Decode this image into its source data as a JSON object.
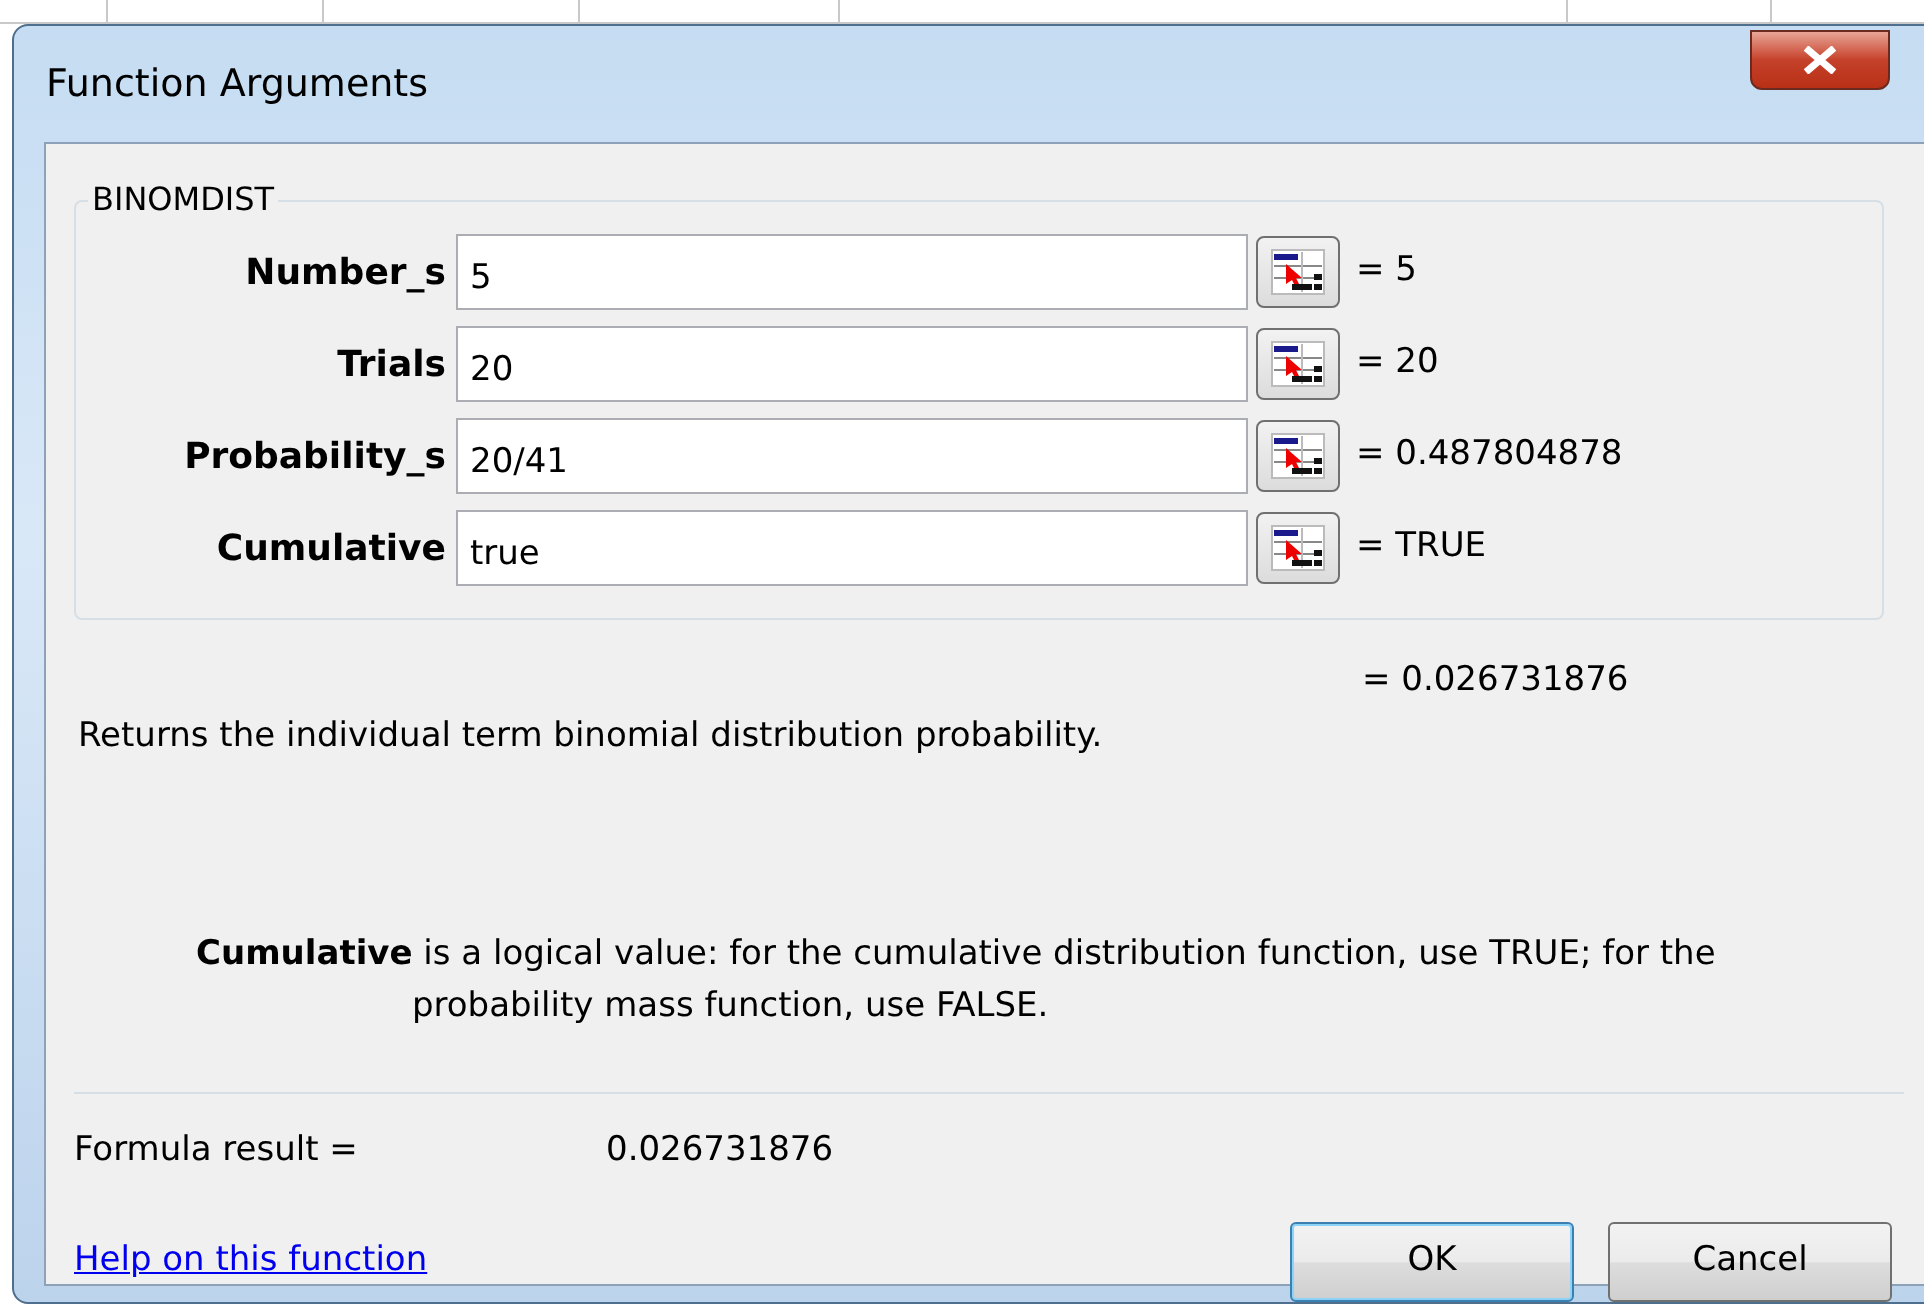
{
  "window": {
    "title": "Function Arguments"
  },
  "function_name": "BINOMDIST",
  "arguments": [
    {
      "label": "Number_s",
      "value": "5",
      "result": "= 5"
    },
    {
      "label": "Trials",
      "value": "20",
      "result": "= 20"
    },
    {
      "label": "Probability_s",
      "value": "20/41",
      "result": "= 0.487804878"
    },
    {
      "label": "Cumulative",
      "value": "true",
      "result": "= TRUE"
    }
  ],
  "overall_result": "= 0.026731876",
  "description": "Returns the individual term binomial distribution probability.",
  "argument_help": {
    "name": "Cumulative",
    "text": "is a logical value: for the cumulative distribution function, use TRUE; for the probability mass function, use FALSE."
  },
  "formula_result": {
    "label": "Formula result =",
    "value": "0.026731876"
  },
  "help_link": "Help on this function",
  "buttons": [
    {
      "label": "OK",
      "default": true
    },
    {
      "label": "Cancel",
      "default": false
    }
  ]
}
